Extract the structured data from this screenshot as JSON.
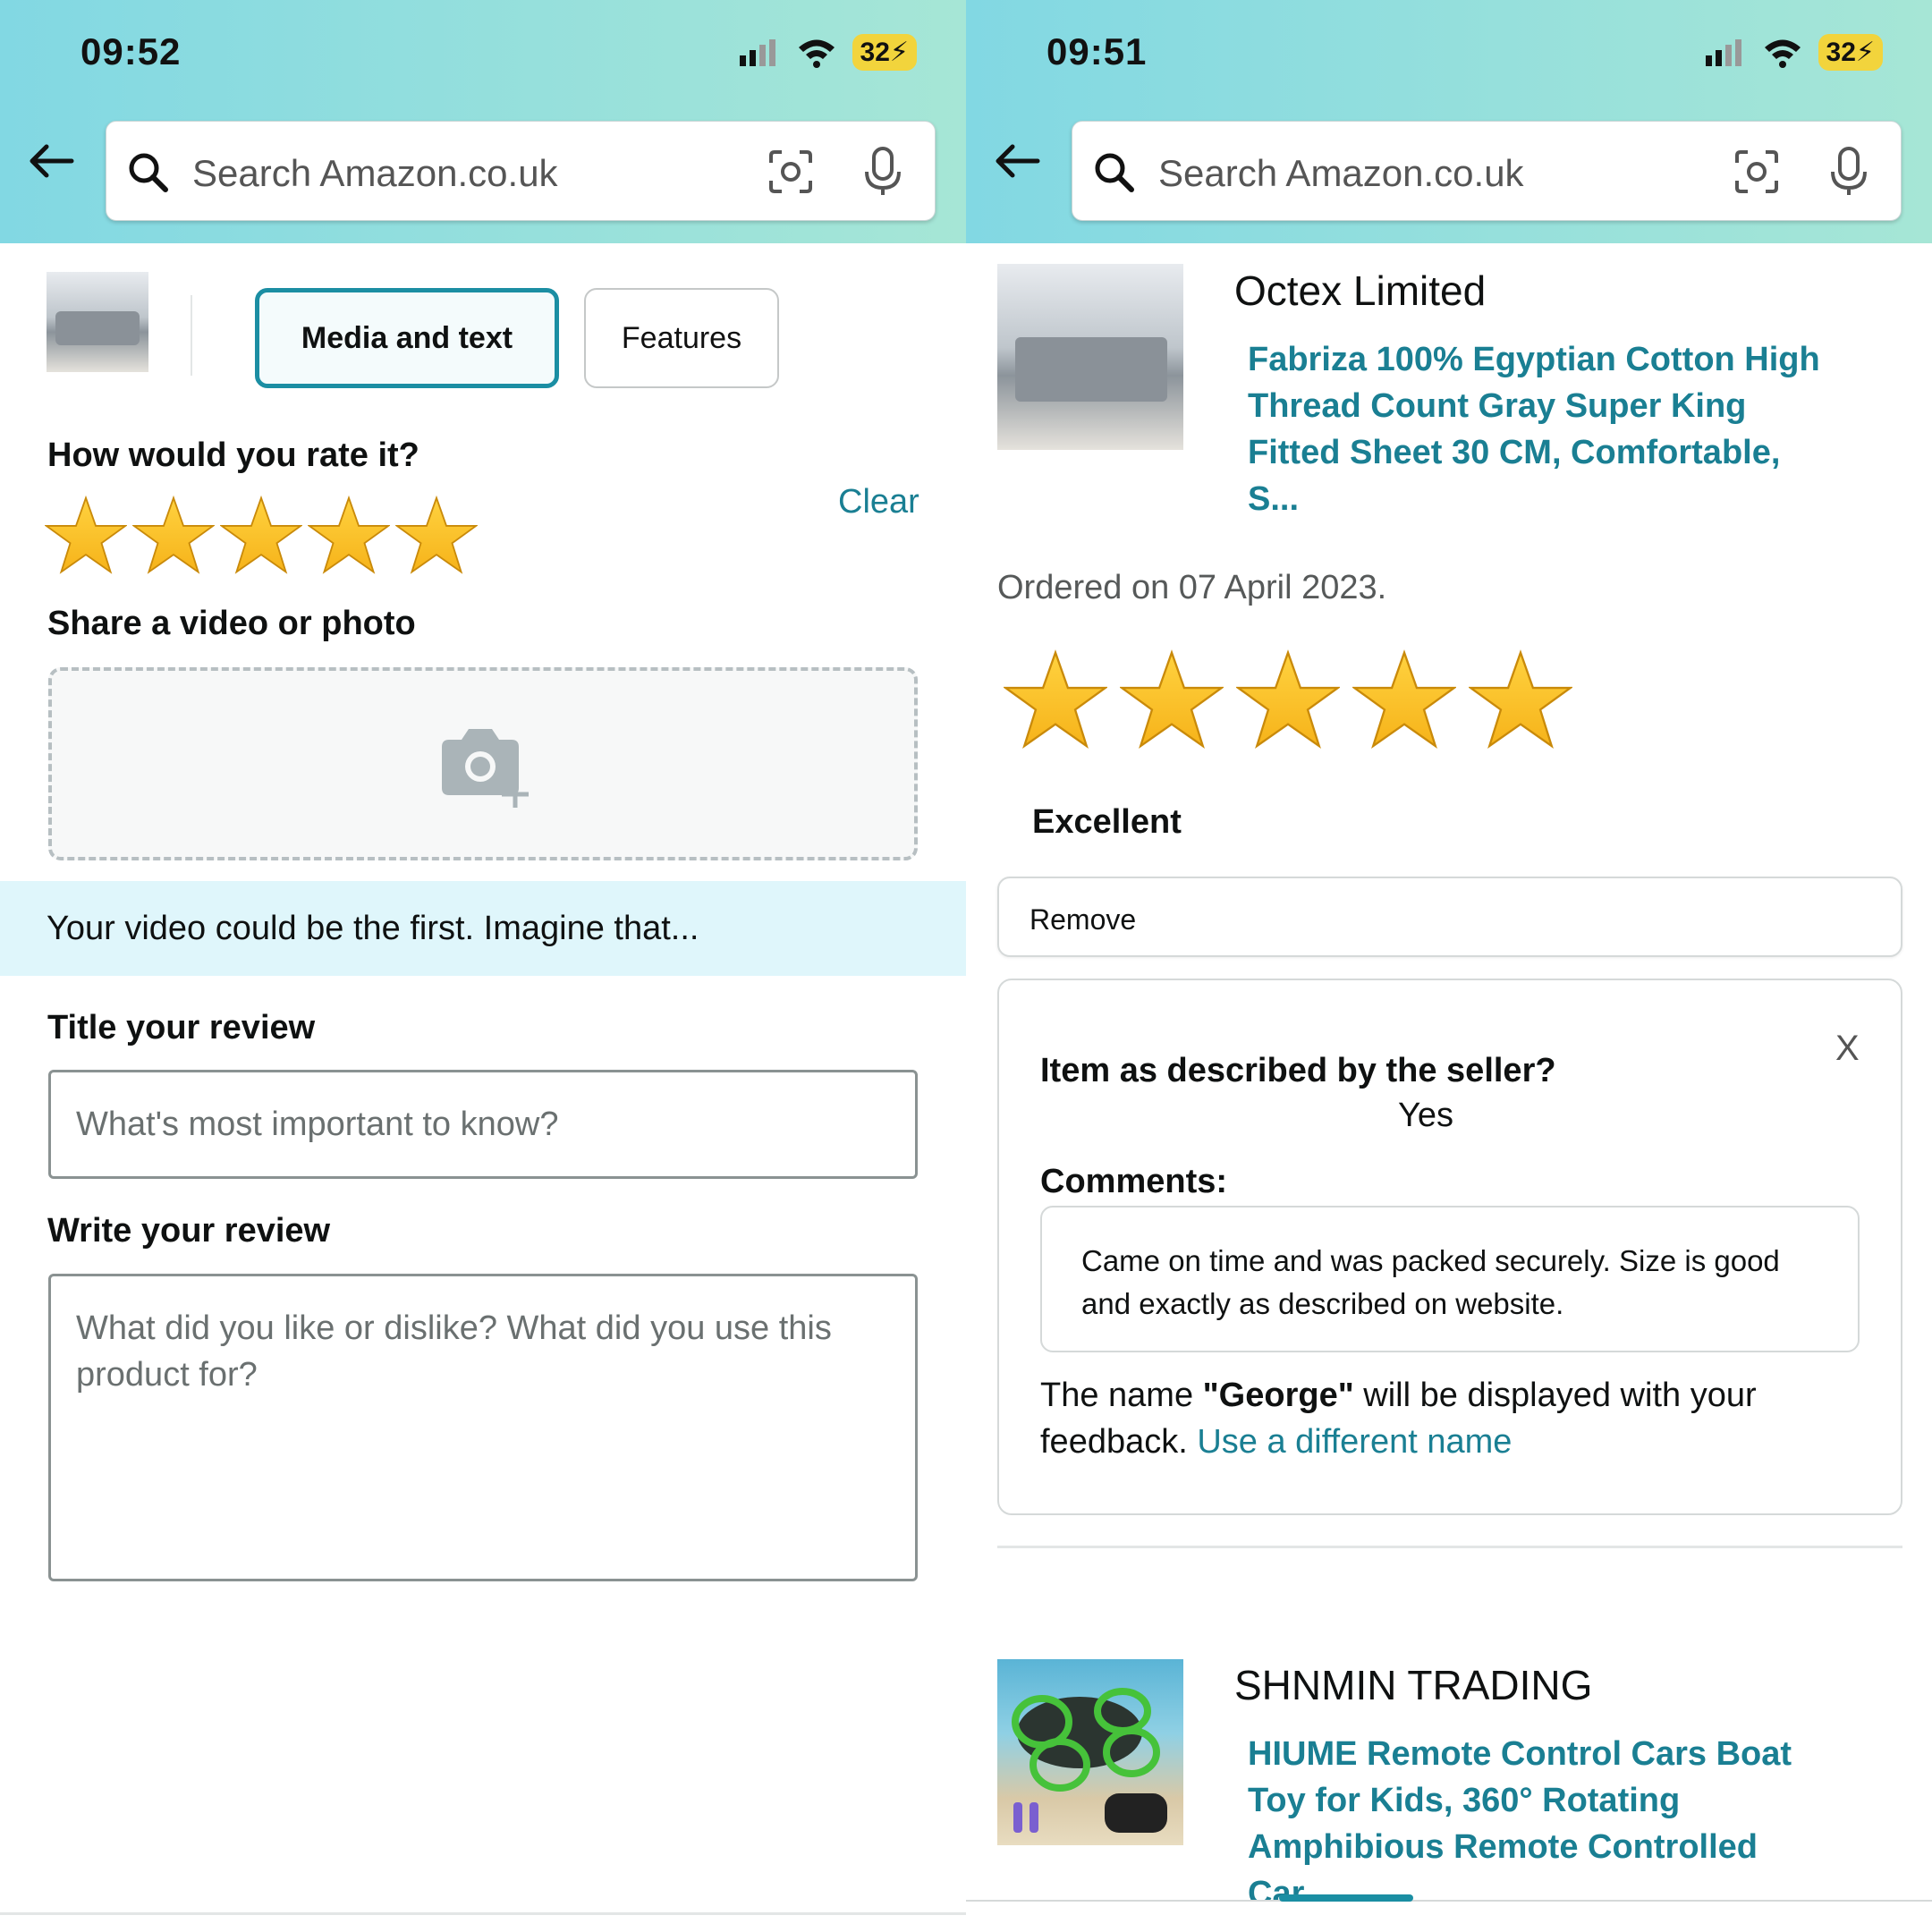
{
  "left": {
    "status": {
      "time": "09:52",
      "battery": "32"
    },
    "search": {
      "placeholder": "Search Amazon.co.uk"
    },
    "tabs": [
      {
        "label": "Media and text",
        "active": true
      },
      {
        "label": "Features",
        "active": false
      }
    ],
    "rating": {
      "heading": "How would you rate it?",
      "stars": 5,
      "max": 5,
      "clear_label": "Clear"
    },
    "upload": {
      "heading": "Share a video or photo"
    },
    "banner": "Your video could be the first. Imagine that...",
    "title_field": {
      "heading": "Title your review",
      "placeholder": "What's most important to know?"
    },
    "review_field": {
      "heading": "Write your review",
      "placeholder": "What did you like or dislike? What did you use this product for?"
    }
  },
  "right": {
    "status": {
      "time": "09:51",
      "battery": "32"
    },
    "search": {
      "placeholder": "Search Amazon.co.uk"
    },
    "order1": {
      "seller": "Octex Limited",
      "product_title": "Fabriza 100% Egyptian Cotton High Thread Count Gray Super King Fitted Sheet 30 CM, Comfortable, S...",
      "ordered_date": "Ordered on 07 April 2023.",
      "stars": 5,
      "rating_word": "Excellent",
      "remove_label": "Remove",
      "question": "Item as described by the seller?",
      "answer": "Yes",
      "comments_label": "Comments:",
      "comment": "Came on time and was packed securely. Size is good and exactly as described on website.",
      "name_note_prefix": "The name ",
      "display_name": "\"George\"",
      "name_note_suffix": " will be displayed with your feedback. ",
      "different_name_link": "Use a different name",
      "close_label": "X"
    },
    "order2": {
      "seller": "SHNMIN TRADING",
      "product_title": "HIUME Remote Control Cars Boat Toy for Kids, 360° Rotating Amphibious Remote Controlled Car..."
    }
  },
  "colors": {
    "accent": "#1a7f93",
    "star": "#f6b31a",
    "header_start": "#82d8e3",
    "header_end": "#a6e6d6",
    "banner": "#dff6fb"
  },
  "icons": [
    "back-arrow-icon",
    "search-icon",
    "camera-scan-icon",
    "microphone-icon",
    "signal-icon",
    "wifi-icon",
    "battery-icon",
    "star-icon",
    "add-photo-icon",
    "close-icon"
  ]
}
